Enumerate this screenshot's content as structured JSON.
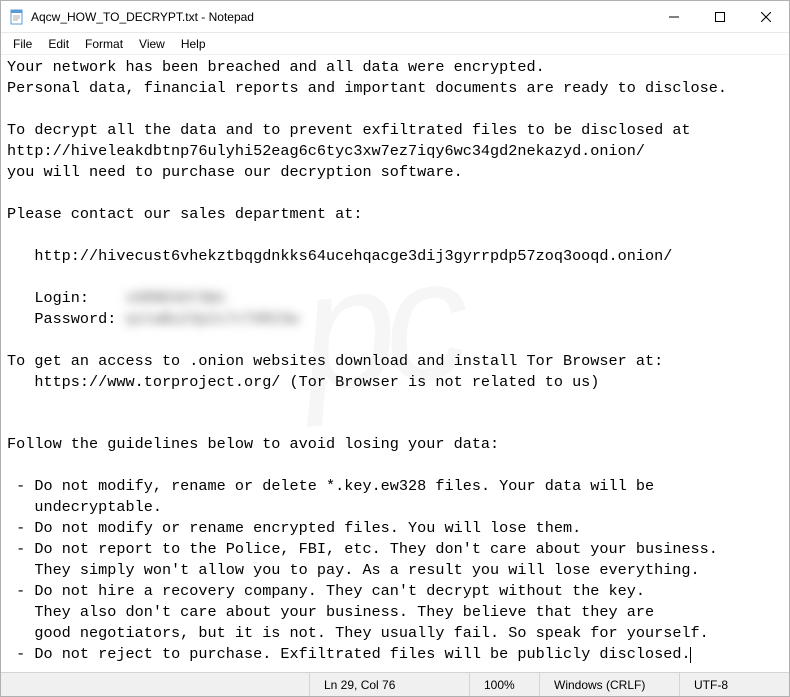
{
  "titlebar": {
    "title": "Aqcw_HOW_TO_DECRYPT.txt - Notepad"
  },
  "menubar": {
    "file": "File",
    "edit": "Edit",
    "format": "Format",
    "view": "View",
    "help": "Help"
  },
  "content": {
    "line1": "Your network has been breached and all data were encrypted.",
    "line2": "Personal data, financial reports and important documents are ready to disclose.",
    "blank1": "",
    "line3": "To decrypt all the data and to prevent exfiltrated files to be disclosed at",
    "line4": "http://hiveleakdbtnp76ulyhi52eag6c6tyc3xw7ez7iqy6wc34gd2nekazyd.onion/",
    "line5": "you will need to purchase our decryption software.",
    "blank2": "",
    "line6": "Please contact our sales department at:",
    "blank3": "",
    "line7": "   http://hivecust6vhekztbqgdnkks64ucehqacge3dij3gyrrpdp57zoq3ooqd.onion/",
    "blank4": "",
    "line8a": "   Login:    ",
    "line8b": "xGRND3AY3Wx",
    "line9a": "   Password: ",
    "line9b": "qxtwBu23p2x7cT6R23w",
    "blank5": "",
    "line10": "To get an access to .onion websites download and install Tor Browser at:",
    "line11": "   https://www.torproject.org/ (Tor Browser is not related to us)",
    "blank6": "",
    "blank7": "",
    "line12": "Follow the guidelines below to avoid losing your data:",
    "blank8": "",
    "line13": " - Do not modify, rename or delete *.key.ew328 files. Your data will be",
    "line14": "   undecryptable.",
    "line15": " - Do not modify or rename encrypted files. You will lose them.",
    "line16": " - Do not report to the Police, FBI, etc. They don't care about your business.",
    "line17": "   They simply won't allow you to pay. As a result you will lose everything.",
    "line18": " - Do not hire a recovery company. They can't decrypt without the key.",
    "line19": "   They also don't care about your business. They believe that they are",
    "line20": "   good negotiators, but it is not. They usually fail. So speak for yourself.",
    "line21": " - Do not reject to purchase. Exfiltrated files will be publicly disclosed."
  },
  "statusbar": {
    "position": "Ln 29, Col 76",
    "zoom": "100%",
    "line_ending": "Windows (CRLF)",
    "encoding": "UTF-8"
  },
  "watermark": "pc"
}
